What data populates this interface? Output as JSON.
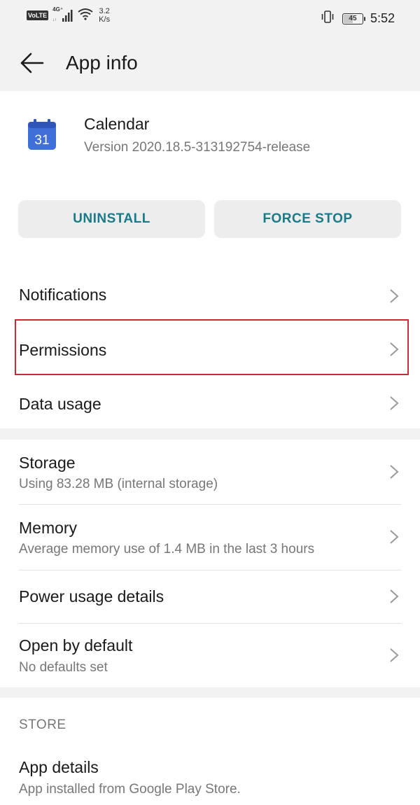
{
  "status_bar": {
    "volte": "VoLTE",
    "network": "4G⁺",
    "speed_value": "3.2",
    "speed_unit": "K/s",
    "battery": "45",
    "time": "5:52"
  },
  "app_bar": {
    "title": "App info",
    "back_icon": "arrow-back-icon"
  },
  "app": {
    "name": "Calendar",
    "version": "Version 2020.18.5-313192754-release",
    "icon_text": "31",
    "icon_color": "#3f6fd8"
  },
  "actions": {
    "uninstall": "UNINSTALL",
    "force_stop": "FORCE STOP",
    "accent": "#1a7a8a"
  },
  "section1": {
    "items": [
      {
        "label": "Notifications"
      },
      {
        "label": "Permissions",
        "highlighted": true
      },
      {
        "label": "Data usage"
      }
    ]
  },
  "section2": {
    "items": [
      {
        "label": "Storage",
        "sub": "Using 83.28 MB (internal storage)"
      },
      {
        "label": "Memory",
        "sub": "Average memory use of 1.4 MB in the last 3 hours"
      },
      {
        "label": "Power usage details"
      },
      {
        "label": "Open by default",
        "sub": "No defaults set"
      }
    ]
  },
  "store": {
    "header": "STORE",
    "items": [
      {
        "label": "App details",
        "sub": "App installed from Google Play Store."
      }
    ]
  },
  "highlight_color": "#cc2b36"
}
